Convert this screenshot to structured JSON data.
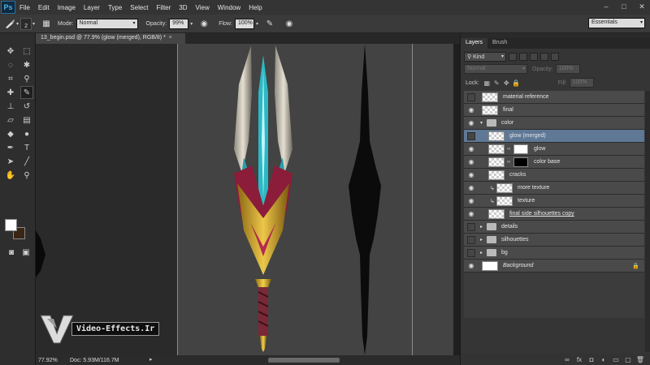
{
  "app": {
    "logo": "Ps"
  },
  "menu": [
    "File",
    "Edit",
    "Image",
    "Layer",
    "Type",
    "Select",
    "Filter",
    "3D",
    "View",
    "Window",
    "Help"
  ],
  "window_controls": [
    "–",
    "□",
    "✕"
  ],
  "options": {
    "brush_size": "2",
    "mode_label": "Mode:",
    "mode_value": "Normal",
    "opacity_label": "Opacity:",
    "opacity_value": "99%",
    "flow_label": "Flow:",
    "flow_value": "100%",
    "workspace": "Essentials"
  },
  "document": {
    "tab_title": "13_begin.psd @ 77.9% (glow (merged), RGB/8) *",
    "close": "×"
  },
  "status": {
    "zoom": "77.92%",
    "doc": "Doc: 5.93M/116.7M"
  },
  "watermark": {
    "text": "Video-Effects.Ir"
  },
  "panels": {
    "tabs": [
      "Layers",
      "Brush"
    ],
    "filter_kind": "Kind",
    "blend_mode": "Normal",
    "opacity_label": "Opacity:",
    "opacity_value": "100%",
    "lock_label": "Lock:",
    "fill_label": "Fill:",
    "fill_value": "100%"
  },
  "layers": [
    {
      "name": "material reference",
      "visible": false
    },
    {
      "name": "final",
      "visible": true
    },
    {
      "name": "color",
      "visible": true
    },
    {
      "name": "glow (merged)",
      "visible": false,
      "selected": true
    },
    {
      "name": "glow",
      "visible": true
    },
    {
      "name": "color base",
      "visible": true
    },
    {
      "name": "cracks",
      "visible": true
    },
    {
      "name": "more texture",
      "visible": true
    },
    {
      "name": "texture",
      "visible": true
    },
    {
      "name": "final side silhouettes copy",
      "visible": true
    },
    {
      "name": "details",
      "visible": false
    },
    {
      "name": "silhouettes",
      "visible": false
    },
    {
      "name": "bg",
      "visible": false
    },
    {
      "name": "Background",
      "visible": true
    }
  ],
  "colors": {
    "foreground": "#ffffff",
    "background": "#3a2614",
    "selection": "#5f7896"
  }
}
